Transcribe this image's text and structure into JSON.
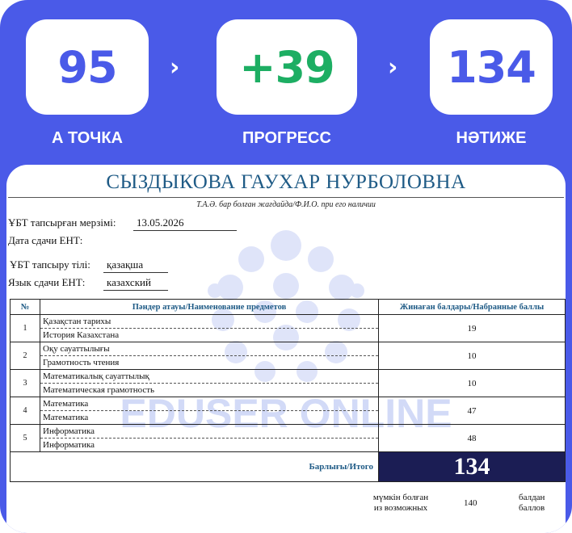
{
  "header": {
    "start_value": "95",
    "progress_value": "+39",
    "result_value": "134",
    "start_label": "А ТОЧКА",
    "progress_label": "ПРОГРЕСС",
    "result_label": "НӘТИЖЕ",
    "arrow": "›"
  },
  "certificate": {
    "full_name": "СЫЗДЫКОВА ГАУХАР НУРБОЛОВНА",
    "name_note": "Т.А.Ә. бар болған жағдайда/Ф.И.О. при его наличии",
    "date_label_kz": "ҰБТ тапсырған мерзімі:",
    "date_label_ru": "Дата сдачи ЕНТ:",
    "date_value": "13.05.2026",
    "lang_label_kz": "ҰБТ тапсыру тілі:",
    "lang_label_ru": "Язык сдачи ЕНТ:",
    "lang_value_kz": "қазақша",
    "lang_value_ru": "казахский",
    "watermark": "EDUSER ONLINE"
  },
  "table": {
    "col_num": "№",
    "col_subject": "Пәндер атауы/Наименование предметов",
    "col_score": "Жинаған балдары/Набранные баллы",
    "rows": [
      {
        "num": "1",
        "kz": "Қазақстан тарихы",
        "ru": "История Казахстана",
        "score": "19"
      },
      {
        "num": "2",
        "kz": "Оқу сауаттылығы",
        "ru": "Грамотность чтения",
        "score": "10"
      },
      {
        "num": "3",
        "kz": "Математикалық сауаттылық",
        "ru": "Математическая грамотность",
        "score": "10"
      },
      {
        "num": "4",
        "kz": "Математика",
        "ru": "Математика",
        "score": "47"
      },
      {
        "num": "5",
        "kz": "Информатика",
        "ru": "Информатика",
        "score": "48"
      }
    ],
    "total_label": "Барлығы/Итого",
    "total_value": "134",
    "possible_kz": "мүмкін болған",
    "possible_ru": "из возможных",
    "possible_value": "140",
    "points_kz": "балдан",
    "points_ru": "баллов"
  }
}
